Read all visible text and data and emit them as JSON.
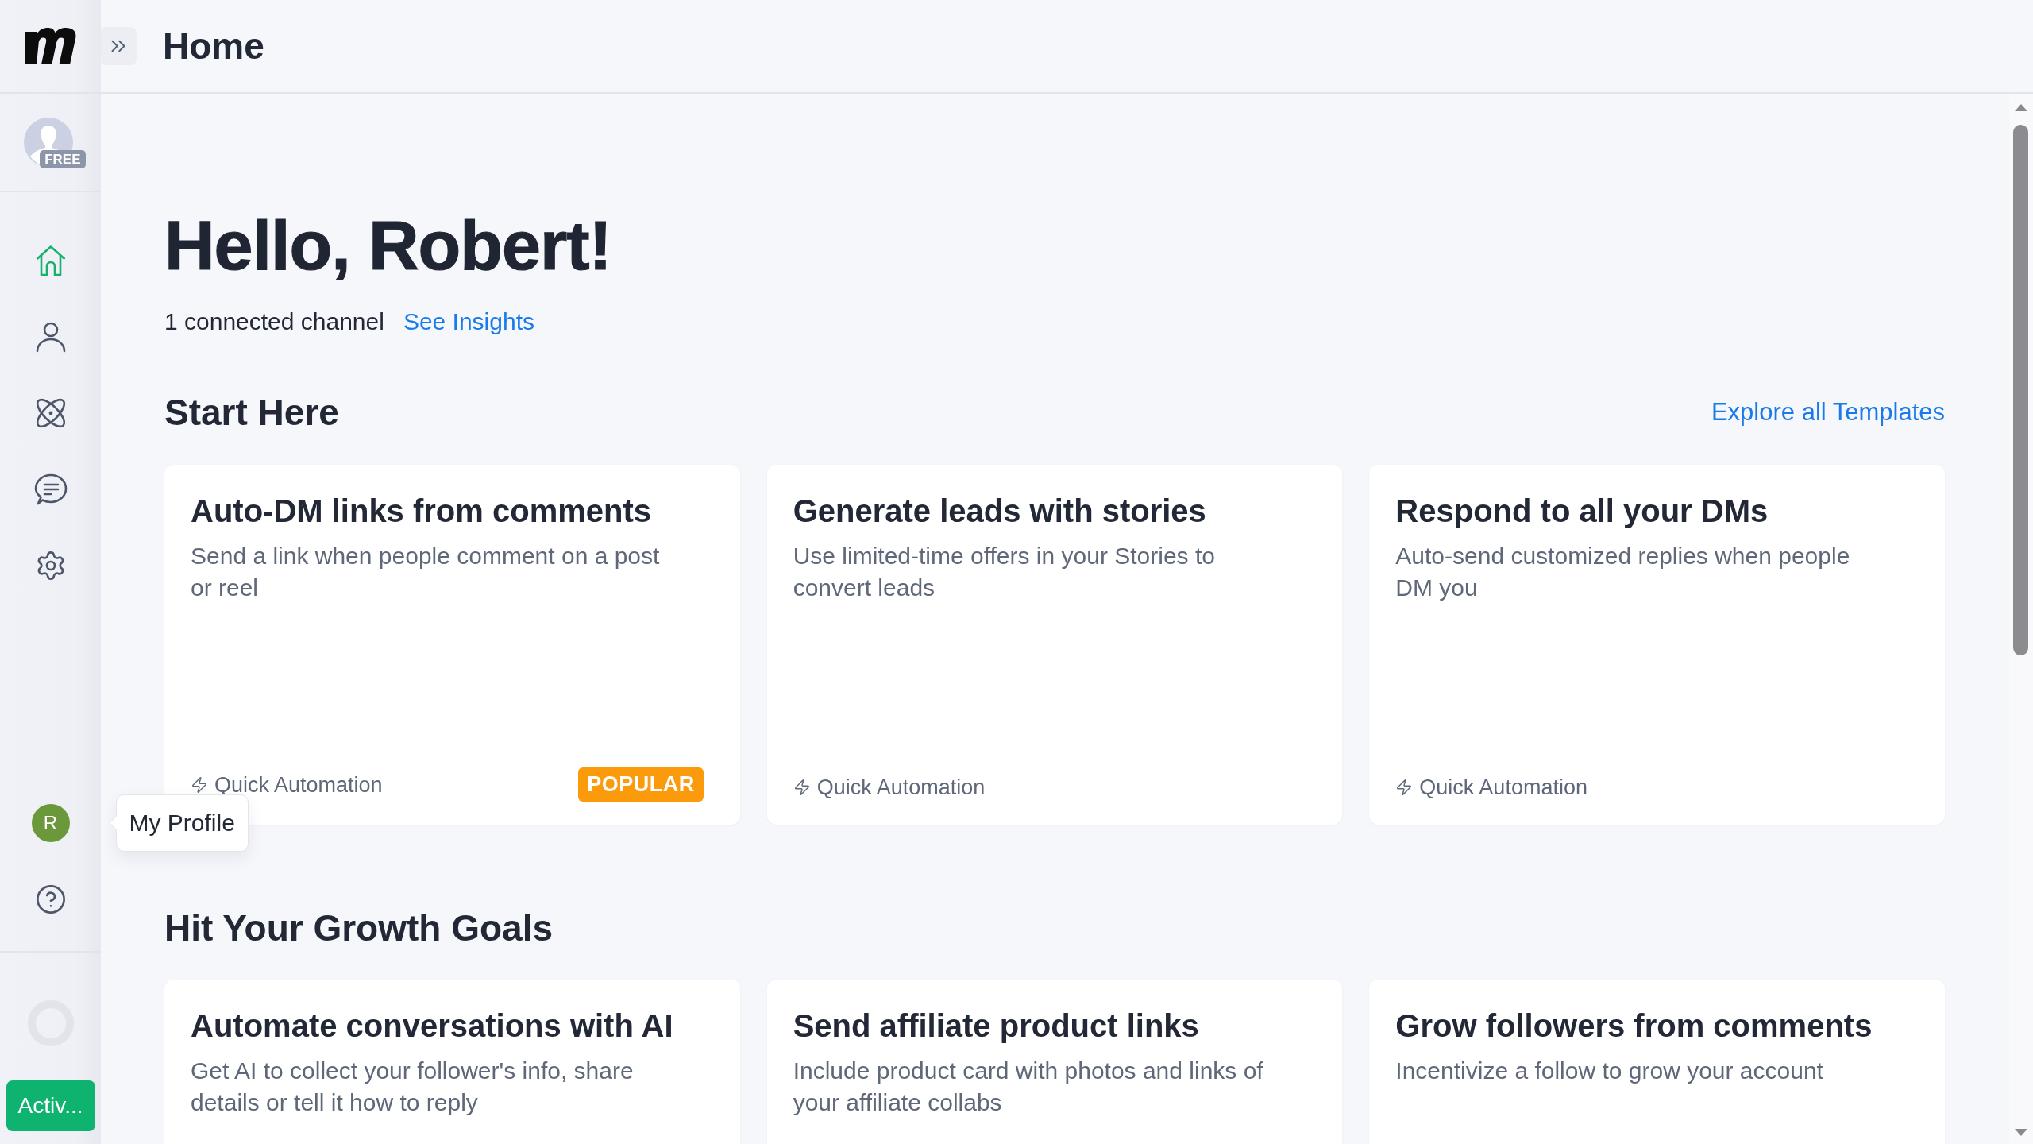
{
  "header": {
    "title": "Home"
  },
  "sidebar": {
    "plan_badge": "FREE",
    "nav": [
      {
        "kind": "home",
        "selected": true
      },
      {
        "kind": "contacts",
        "selected": false
      },
      {
        "kind": "automation",
        "selected": false
      },
      {
        "kind": "chats",
        "selected": false
      },
      {
        "kind": "settings",
        "selected": false
      }
    ],
    "profile": {
      "initial": "R",
      "tooltip": "My Profile"
    },
    "activate_button": "Activ..."
  },
  "greeting": {
    "title": "Hello, Robert!",
    "channels": "1 connected channel",
    "link": "See Insights"
  },
  "sections": [
    {
      "title": "Start Here",
      "link": "Explore all Templates",
      "cards": [
        {
          "title": "Auto-DM links from comments",
          "description": "Send a link when people comment on a post or reel",
          "tag": "Quick Automation",
          "badge": "POPULAR"
        },
        {
          "title": "Generate leads with stories",
          "description": "Use limited-time offers in your Stories to convert leads",
          "tag": "Quick Automation"
        },
        {
          "title": "Respond to all your DMs",
          "description": "Auto-send customized replies when people DM you",
          "tag": "Quick Automation"
        }
      ]
    },
    {
      "title": "Hit Your Growth Goals",
      "cards": [
        {
          "title": "Automate conversations with AI",
          "description": "Get AI to collect your follower's info, share details or tell it how to reply"
        },
        {
          "title": "Send affiliate product links",
          "description": "Include product card with photos and links of your affiliate collabs"
        },
        {
          "title": "Grow followers from comments",
          "description": "Incentivize a follow to grow your account"
        }
      ]
    }
  ]
}
